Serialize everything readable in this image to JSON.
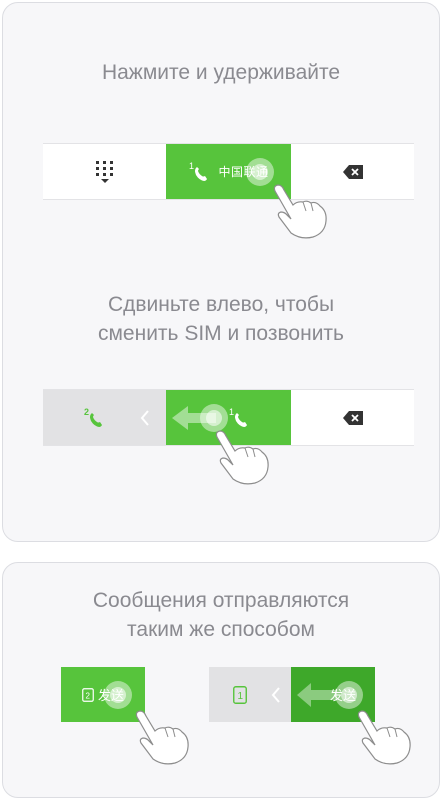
{
  "section1": {
    "heading": "Нажмите и удерживайте",
    "carrier_label": "中国联通",
    "sim_number": "1"
  },
  "section2": {
    "heading_line1": "Сдвиньте влево, чтобы",
    "heading_line2": "сменить SIM и позвонить",
    "sim_left_number": "2",
    "sim_right_number": "1"
  },
  "section3": {
    "heading_line1": "Сообщения отправляются",
    "heading_line2": "таким же способом",
    "send_label": "发送",
    "sim_a_number": "2",
    "sim_b_number": "1"
  },
  "colors": {
    "green": "#57c43c",
    "dark_green": "#3ea82a",
    "gray_seg": "#e2e2e4",
    "heading": "#8a8a90"
  }
}
